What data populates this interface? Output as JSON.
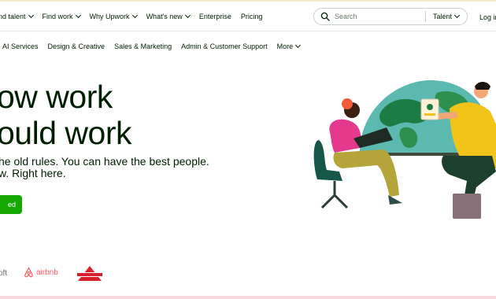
{
  "nav": {
    "items": [
      {
        "label": "nd talent"
      },
      {
        "label": "Find work"
      },
      {
        "label": "Why Upwork"
      },
      {
        "label": "What's new"
      },
      {
        "label": "Enterprise"
      },
      {
        "label": "Pricing"
      }
    ],
    "search_placeholder": "Search",
    "search_scope": "Talent",
    "login": "Log in"
  },
  "categories": [
    {
      "label": "AI Services"
    },
    {
      "label": "Design & Creative"
    },
    {
      "label": "Sales & Marketing"
    },
    {
      "label": "Admin & Customer Support"
    },
    {
      "label": "More"
    }
  ],
  "hero": {
    "headline_line1": "ow work",
    "headline_line2": "ould work",
    "sub_line1": "he old rules. You can have the best people.",
    "sub_line2": "w. Right here.",
    "cta": "ed"
  },
  "logos": {
    "microsoft": "oft",
    "airbnb": "airbnb",
    "bissell": "BISSELL"
  },
  "colors": {
    "brand_green": "#14a800",
    "text": "#001e00",
    "airbnb": "#ff5a5f",
    "bissell": "#d8202a"
  }
}
